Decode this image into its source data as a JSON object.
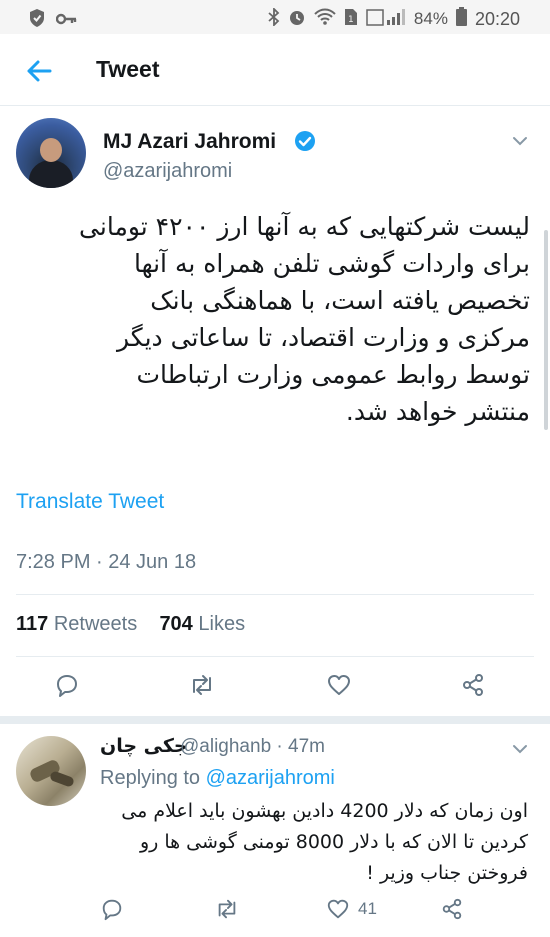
{
  "status_bar": {
    "battery_percent": "84%",
    "time": "20:20",
    "left_icons": [
      "shield-icon",
      "key-icon"
    ],
    "right_icons": [
      "bluetooth-icon",
      "alarm-icon",
      "wifi-icon",
      "sim-icon",
      "signal-icon",
      "battery-icon"
    ]
  },
  "header": {
    "title": "Tweet",
    "back_icon": "arrow-left-icon"
  },
  "tweet": {
    "author_name": "MJ Azari Jahromi",
    "handle": "@azarijahromi",
    "text_lines": [
      "لیست شرکتهایی که به آنها ارز ۴۲۰۰ تومانی",
      "برای واردات گوشی تلفن همراه به آنها",
      "تخصیص یافته است، با هماهنگی بانک",
      "مرکزی و وزارت اقتصاد، تا ساعاتی دیگر",
      "توسط روابط عمومی وزارت ارتباطات",
      "منتشر خواهد شد."
    ],
    "translate_label": "Translate Tweet",
    "timestamp": "7:28 PM · 24 Jun 18",
    "retweets_count": "117",
    "retweets_label": "Retweets",
    "likes_count": "704",
    "likes_label": "Likes"
  },
  "reply": {
    "author_name": "جکی چان",
    "meta": "@alighanb · 47m",
    "replying_prefix": "Replying to",
    "replying_handle": "@azarijahromi",
    "text_lines": [
      "اون زمان که دلار 4200 دادین بهشون باید اعلام می",
      "کردین تا الان که با دلار 8000 تومنی گوشی ها رو",
      "فروختن جناب وزیر !"
    ],
    "likes_count": "41"
  },
  "colors": {
    "accent": "#1da1f2",
    "secondary_text": "#657786",
    "divider": "#e6ecf0"
  }
}
